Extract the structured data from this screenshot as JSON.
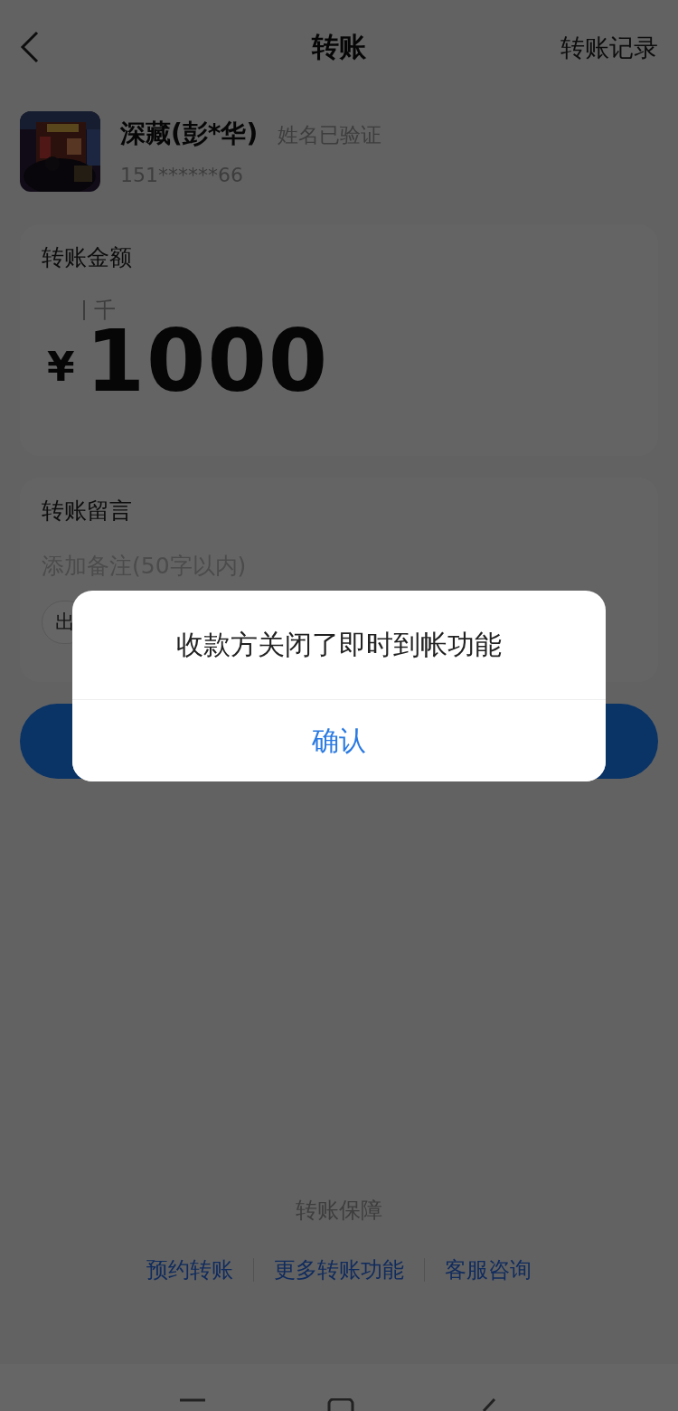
{
  "header": {
    "title": "转账",
    "action": "转账记录"
  },
  "recipient": {
    "name": "深藏(彭*华)",
    "verified": "姓名已验证",
    "phone": "151******66"
  },
  "amount": {
    "label": "转账金额",
    "unit_hint": "千",
    "currency": "¥",
    "value": "1000"
  },
  "remark": {
    "label": "转账留言",
    "placeholder": "添加备注(50字以内)",
    "chip": "出"
  },
  "dialog": {
    "message": "收款方关闭了即时到帐功能",
    "button": "确认"
  },
  "footer": {
    "title": "转账保障",
    "links": [
      "预约转账",
      "更多转账功能",
      "客服咨询"
    ]
  }
}
